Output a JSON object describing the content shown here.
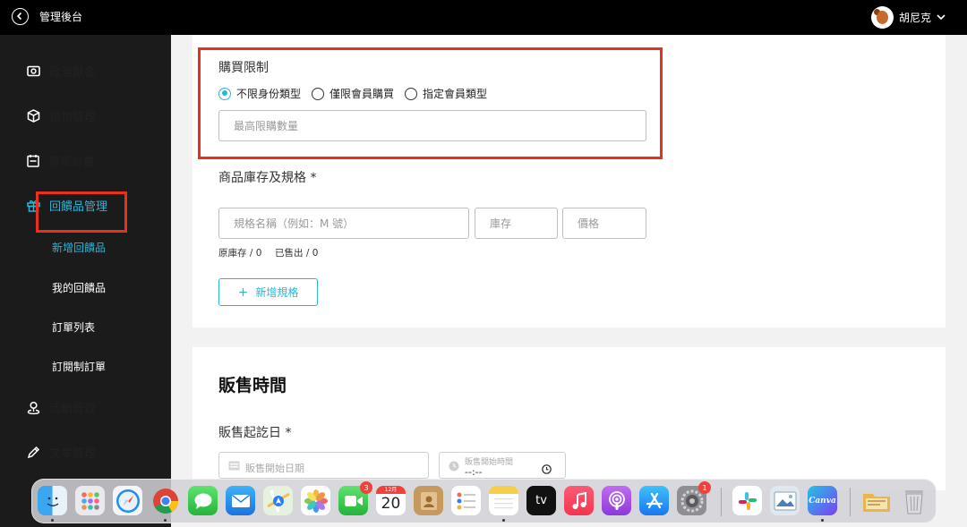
{
  "topbar": {
    "title": "管理後台",
    "user_name": "胡尼克"
  },
  "sidebar": {
    "items": [
      {
        "label": "政治獻金",
        "icon": "camera-icon"
      },
      {
        "label": "捐物管理",
        "icon": "box-icon"
      },
      {
        "label": "專案計畫",
        "icon": "calendar-icon"
      },
      {
        "label": "回饋品管理",
        "icon": "gift-icon"
      },
      {
        "label": "活動管理",
        "icon": "location-pin-icon"
      },
      {
        "label": "文章管理",
        "icon": "pen-icon"
      }
    ],
    "sub_items": [
      {
        "label": "新增回饋品"
      },
      {
        "label": "我的回饋品"
      },
      {
        "label": "訂單列表"
      },
      {
        "label": "訂閱制訂單"
      }
    ]
  },
  "purchase_limit": {
    "label": "購買限制",
    "options": [
      "不限身份類型",
      "僅限會員購買",
      "指定會員類型"
    ],
    "selected_index": 0,
    "max_qty_placeholder": "最高限購數量"
  },
  "inventory": {
    "label": "商品庫存及規格 *",
    "spec_placeholder": "規格名稱（例如：M 號）",
    "stock_placeholder": "庫存",
    "price_placeholder": "價格",
    "original_stock": "原庫存 / 0",
    "sold": "已售出 / 0",
    "add_spec_label": "新增規格"
  },
  "sale_time": {
    "title": "販售時間",
    "date_label": "販售起訖日 *",
    "start_date_placeholder": "販售開始日期",
    "start_time_label": "販售開始時間",
    "start_time_value": "--:--"
  },
  "dock": {
    "apps": [
      "Finder",
      "Launchpad",
      "Safari",
      "Chrome",
      "Messages",
      "Mail",
      "Maps",
      "Photos",
      "FaceTime",
      "Calendar",
      "Contacts",
      "Reminders",
      "Notes",
      "TV",
      "Music",
      "Podcasts",
      "App Store",
      "System Settings",
      "Slack",
      "Preview",
      "Canva",
      "Downloads",
      "Trash"
    ],
    "calendar_month": "12月",
    "calendar_day": "20",
    "facetime_badge": "3",
    "settings_badge": "1",
    "tv_label": "tv",
    "canva_label": "Canva"
  },
  "colors": {
    "accent": "#2bb6d8",
    "highlight": "#e8301c"
  }
}
